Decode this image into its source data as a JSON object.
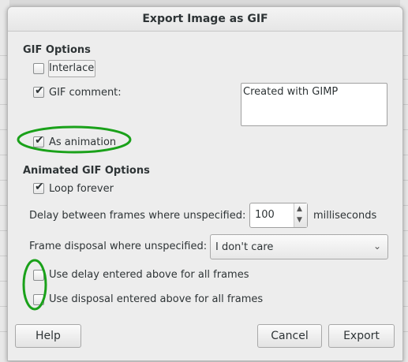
{
  "dialog": {
    "title": "Export Image as GIF"
  },
  "gif_options": {
    "heading": "GIF Options",
    "interlace": {
      "label": "Interlace",
      "checked": false
    },
    "gif_comment": {
      "label": "GIF comment:",
      "checked": true,
      "value": "Created with GIMP"
    },
    "as_animation": {
      "label": "As animation",
      "checked": true
    }
  },
  "animated_options": {
    "heading": "Animated GIF Options",
    "loop_forever": {
      "label": "Loop forever",
      "checked": true
    },
    "delay": {
      "label": "Delay between frames where unspecified:",
      "value": "100",
      "unit": "milliseconds"
    },
    "disposal": {
      "label": "Frame disposal where unspecified:",
      "value": "I don't care"
    },
    "use_delay_all": {
      "label": "Use delay entered above for all frames",
      "checked": false
    },
    "use_disposal_all": {
      "label": "Use disposal entered above for all frames",
      "checked": false
    }
  },
  "buttons": {
    "help": "Help",
    "cancel": "Cancel",
    "export": "Export"
  },
  "colors": {
    "annotation": "#1aa11a",
    "dialog_bg": "#ededed"
  },
  "icons": {
    "check": "checkmark-icon",
    "spin_up": "chevron-up-icon",
    "spin_down": "chevron-down-icon",
    "combo": "chevron-down-icon"
  }
}
